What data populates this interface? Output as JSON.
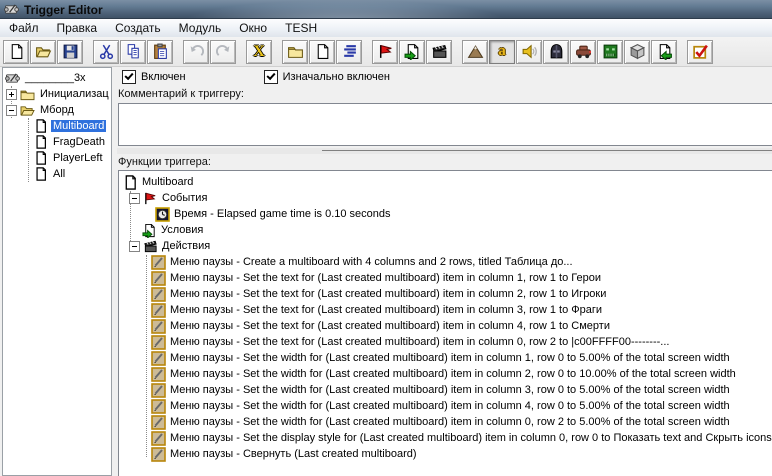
{
  "window": {
    "title": "Trigger Editor"
  },
  "menu": {
    "items": [
      {
        "label": "Файл"
      },
      {
        "label": "Правка"
      },
      {
        "label": "Создать"
      },
      {
        "label": "Модуль"
      },
      {
        "label": "Окно"
      },
      {
        "label": "TESH"
      }
    ]
  },
  "toolbar": {
    "buttons": [
      "new-file",
      "open-map",
      "save-map",
      "cut",
      "copy",
      "paste",
      "undo",
      "redo",
      "delete",
      "new-category",
      "new-trigger",
      "trigger-comment",
      "new-event",
      "new-condition",
      "new-action",
      "terrain-editor",
      "trigger-editor",
      "sound-editor",
      "object-editor",
      "campaign-editor",
      "ai-editor",
      "object-manager",
      "import-manager",
      "test-map"
    ],
    "glyphs": {
      "delete_x": "X",
      "trigger_editor_a": "a"
    }
  },
  "tree": {
    "root_label": "________3x",
    "items": [
      {
        "label": "Инициализац"
      },
      {
        "label": "Мборд"
      },
      {
        "label": "Multiboard",
        "selected": true
      },
      {
        "label": "FragDeath"
      },
      {
        "label": "PlayerLeft"
      },
      {
        "label": "All"
      }
    ]
  },
  "detail": {
    "enabled_label": "Включен",
    "initially_on_label": "Изначально включен",
    "comment_label": "Комментарий к триггеру:",
    "comment_value": "",
    "functions_label": "Функции триггера:"
  },
  "functions": {
    "trigger_name": "Multiboard",
    "events_label": "События",
    "event_text": "Время - Elapsed game time is 0.10 seconds",
    "conditions_label": "Условия",
    "actions_label": "Действия",
    "actions": [
      "Меню паузы - Create a multiboard with 4 columns and 2 rows, titled Таблица до...",
      "Меню паузы - Set the text for (Last created multiboard) item in column 1, row 1 to Герои",
      "Меню паузы - Set the text for (Last created multiboard) item in column 2, row 1 to Игроки",
      "Меню паузы - Set the text for (Last created multiboard) item in column 3, row 1 to Фраги",
      "Меню паузы - Set the text for (Last created multiboard) item in column 4, row 1 to Смерти",
      "Меню паузы - Set the text for (Last created multiboard) item in column 0, row 2 to |c00FFFF00--------...",
      "Меню паузы - Set the width for (Last created multiboard) item in column 1, row 0 to 5.00% of the total screen width",
      "Меню паузы - Set the width for (Last created multiboard) item in column 2, row 0 to 10.00% of the total screen width",
      "Меню паузы - Set the width for (Last created multiboard) item in column 3, row 0 to 5.00% of the total screen width",
      "Меню паузы - Set the width for (Last created multiboard) item in column 4, row 0 to 5.00% of the total screen width",
      "Меню паузы - Set the width for (Last created multiboard) item in column 0, row 2 to 5.00% of the total screen width",
      "Меню паузы - Set the display style for (Last created multiboard) item in column 0, row 0 to Показать text and Скрыть icons",
      "Меню паузы - Свернуть (Last created multiboard)"
    ]
  }
}
